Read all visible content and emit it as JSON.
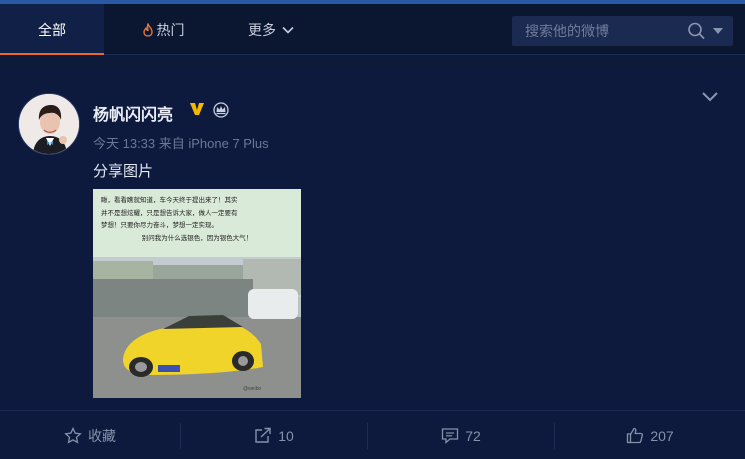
{
  "nav": {
    "tabs": [
      {
        "label": "全部",
        "active": true
      },
      {
        "label": "热门",
        "icon": "fire-icon"
      },
      {
        "label": "更多",
        "icon": "chevron-down-icon"
      }
    ],
    "search": {
      "placeholder": "搜索他的微博"
    }
  },
  "post": {
    "username": "杨帆闪闪亮",
    "verified_badge": "V",
    "meta": "今天 13:33 来自 iPhone 7 Plus",
    "text": "分享图片",
    "image": {
      "caption_lines": [
        "瞅，看看瞧就知道，车今天终于提出来了！其实",
        "并不是想炫耀，只是想告诉大家，做人一定要有",
        "梦想！只要你尽力奋斗，梦想一定实现。",
        "别问我为什么选银色，因为银色大气！"
      ],
      "watermark": "@weibo"
    }
  },
  "actions": {
    "favorite": {
      "label": "收藏"
    },
    "share": {
      "count": "10"
    },
    "comment": {
      "count": "72"
    },
    "like": {
      "count": "207"
    }
  },
  "colors": {
    "background": "#0e1a3a",
    "nav_background": "#0b1631",
    "active_tab_underline": "#e8692a",
    "hot_icon": "#f07a3a",
    "verified_badge": "#f5b800"
  }
}
